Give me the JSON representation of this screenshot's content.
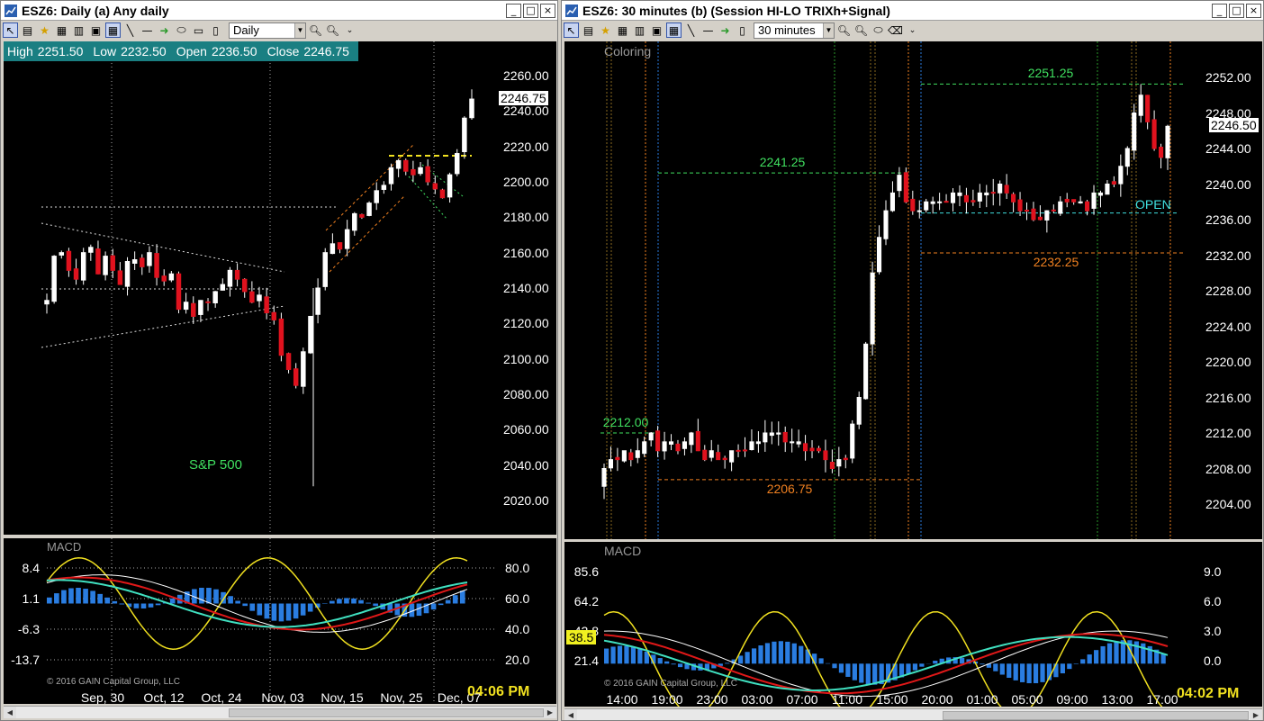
{
  "windowA": {
    "title": "ESZ6: Daily (a) Any daily",
    "timeframe": "Daily",
    "ohlc": {
      "high_label": "High",
      "high": "2251.50",
      "low_label": "Low",
      "low": "2232.50",
      "open_label": "Open",
      "open": "2236.50",
      "close_label": "Close",
      "close": "2246.75"
    },
    "price_tag": "2246.75",
    "chart_label": "S&P 500",
    "indicator_label": "MACD",
    "copyright": "© 2016 GAIN Capital Group, LLC",
    "clock": "04:06 PM"
  },
  "windowB": {
    "title": "ESZ6: 30 minutes (b) (Session HI-LO TRIXh+Signal)",
    "timeframe": "30 minutes",
    "coloring_label": "Coloring",
    "price_tag": "2246.50",
    "open_label": "OPEN",
    "indicator_label": "MACD",
    "macd_tag": "38.5",
    "copyright": "© 2016 GAIN Capital Group, LLC",
    "clock": "04:02 PM",
    "level_labels": [
      "2251.25",
      "2241.25",
      "2232.25",
      "2212.00",
      "2206.75"
    ]
  },
  "chart_data": [
    {
      "type": "candlestick",
      "symbol": "ESZ6",
      "interval": "Daily",
      "x_tick_labels": [
        "Sep, 30",
        "Oct, 12",
        "Oct, 24",
        "Nov, 03",
        "Nov, 15",
        "Nov, 25",
        "Dec, 07"
      ],
      "y_tick_labels": [
        "2260.00",
        "2240.00",
        "2220.00",
        "2200.00",
        "2180.00",
        "2160.00",
        "2140.00",
        "2120.00",
        "2100.00",
        "2080.00",
        "2060.00",
        "2040.00",
        "2020.00"
      ],
      "ylim": [
        2010,
        2270
      ],
      "last_close": 2246.75,
      "high": 2251.5,
      "low": 2232.5,
      "open": 2236.5,
      "close": 2246.75,
      "closes": [
        2133,
        2158,
        2160,
        2150,
        2145,
        2160,
        2163,
        2148,
        2158,
        2150,
        2142,
        2155,
        2156,
        2152,
        2160,
        2146,
        2144,
        2148,
        2128,
        2132,
        2124,
        2133,
        2132,
        2138,
        2142,
        2150,
        2145,
        2138,
        2132,
        2136,
        2126,
        2122,
        2102,
        2094,
        2085,
        2104,
        2124,
        2140,
        2160,
        2165,
        2162,
        2173,
        2182,
        2180,
        2188,
        2195,
        2198,
        2208,
        2212,
        2206,
        2204,
        2208,
        2200,
        2196,
        2191,
        2204,
        2216,
        2236,
        2246.75
      ],
      "subchart": {
        "name": "MACD",
        "left_ticks": [
          "8.4",
          "1.1",
          "-6.3",
          "-13.7"
        ],
        "right_ticks": [
          "80.0",
          "60.0",
          "40.0",
          "20.0"
        ]
      }
    },
    {
      "type": "candlestick",
      "symbol": "ESZ6",
      "interval": "30 minutes",
      "x_tick_labels": [
        "14:00",
        "19:00",
        "23:00",
        "03:00",
        "07:00",
        "11:00",
        "15:00",
        "20:00",
        "01:00",
        "05:00",
        "09:00",
        "13:00",
        "17:00"
      ],
      "y_tick_labels": [
        "2252.00",
        "2248.00",
        "2244.00",
        "2240.00",
        "2236.00",
        "2232.00",
        "2228.00",
        "2224.00",
        "2220.00",
        "2216.00",
        "2212.00",
        "2208.00",
        "2204.00"
      ],
      "ylim": [
        2201,
        2255
      ],
      "last_close": 2246.5,
      "levels": [
        2251.25,
        2241.25,
        2232.25,
        2212.0,
        2206.75
      ],
      "open_level": 2236.75,
      "closes": [
        2208,
        2209,
        2209,
        2210,
        2209,
        2210,
        2211,
        2212,
        2210,
        2211,
        2211,
        2210,
        2211,
        2212,
        2210,
        2209,
        2210,
        2209,
        2209,
        2210,
        2210,
        2210,
        2211,
        2211,
        2212,
        2212,
        2212,
        2211,
        2211,
        2211,
        2210,
        2210,
        2210,
        2209,
        2208,
        2209,
        2209,
        2213,
        2216,
        2222,
        2230,
        2234,
        2237,
        2239,
        2241,
        2238,
        2237,
        2237,
        2238,
        2238,
        2238,
        2238,
        2239,
        2239,
        2238,
        2238,
        2239,
        2239,
        2239,
        2240,
        2239,
        2238,
        2237,
        2237,
        2236,
        2236,
        2237,
        2237,
        2238,
        2238,
        2238,
        2238,
        2237,
        2239,
        2239,
        2240,
        2240,
        2242,
        2244,
        2248,
        2250,
        2247,
        2244,
        2243,
        2246.5
      ],
      "subchart": {
        "name": "MACD",
        "left_ticks": [
          "85.6",
          "64.2",
          "42.8",
          "21.4"
        ],
        "right_ticks": [
          "9.0",
          "6.0",
          "3.0",
          "0.0"
        ],
        "current_value": 38.5
      }
    }
  ]
}
